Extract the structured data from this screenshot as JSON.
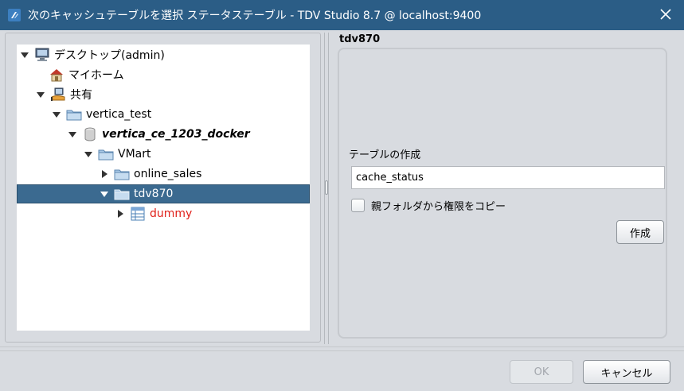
{
  "window": {
    "title": "次のキャッシュテーブルを選択 ステータステーブル - TDV Studio 8.7 @ localhost:9400"
  },
  "tree": {
    "items": [
      {
        "label": "デスクトップ(admin)",
        "icon": "desktop-icon",
        "toggle": "expanded",
        "depth": 0
      },
      {
        "label": "マイホーム",
        "icon": "home-icon",
        "toggle": "none",
        "depth": 1
      },
      {
        "label": "共有",
        "icon": "shared-icon",
        "toggle": "expanded",
        "depth": 1
      },
      {
        "label": "vertica_test",
        "icon": "folder-icon",
        "toggle": "expanded",
        "depth": 2
      },
      {
        "label": "vertica_ce_1203_docker",
        "icon": "database-icon",
        "toggle": "expanded",
        "depth": 3
      },
      {
        "label": "VMart",
        "icon": "folder-icon",
        "toggle": "expanded",
        "depth": 4
      },
      {
        "label": "online_sales",
        "icon": "folder-icon",
        "toggle": "collapsed",
        "depth": 5
      },
      {
        "label": "tdv870",
        "icon": "folder-icon",
        "toggle": "expanded",
        "depth": 5,
        "selected": true
      },
      {
        "label": "dummy",
        "icon": "table-icon",
        "toggle": "collapsed",
        "depth": 6
      }
    ]
  },
  "detail": {
    "header": "tdv870",
    "create_label": "テーブルの作成",
    "table_name_value": "cache_status",
    "copy_permissions_label": "親フォルダから権限をコピー",
    "create_button": "作成"
  },
  "footer": {
    "ok_button": "OK",
    "cancel_button": "キャンセル"
  }
}
